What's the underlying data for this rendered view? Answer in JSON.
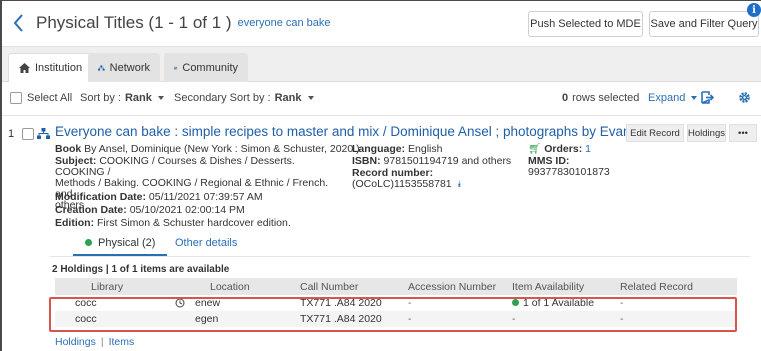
{
  "header": {
    "title": "Physical Titles (1 - 1 of 1 )",
    "query": "everyone can bake",
    "push_label": "Push Selected to MDE",
    "save_label": "Save and Filter Query",
    "info_badge": "i"
  },
  "tabs": [
    {
      "label": "Institution",
      "icon": "home-icon",
      "active": true
    },
    {
      "label": "Network",
      "icon": "network-icon",
      "active": false
    },
    {
      "label": "Community",
      "icon": "community-icon",
      "active": false
    }
  ],
  "toolbar": {
    "select_all": "Select All",
    "sort_label": "Sort by :",
    "sort_value": "Rank",
    "secondary_sort_label": "Secondary Sort by :",
    "secondary_sort_value": "Rank",
    "rows_selected_count": "0",
    "rows_selected_label": "rows selected",
    "expand_label": "Expand"
  },
  "record": {
    "number": "1",
    "title": "Everyone can bake : simple recipes to master and mix / Dominique Ansel ; photographs by Evan Sung.",
    "edit_record_label": "Edit Record",
    "holdings_label": "Holdings",
    "more_label": "•••",
    "book_type": "Book",
    "book_line": "By Ansel, Dominique (New York : Simon & Schuster, 2020.)",
    "subject_label": "Subject:",
    "subject_line1": "COOKING / Courses & Dishes / Desserts. COOKING /",
    "subject_line2": "Methods / Baking. COOKING / Regional & Ethnic / French. and",
    "subject_line3": "others",
    "modification_label": "Modification Date:",
    "modification_value": "05/11/2021 07:39:57 AM",
    "creation_label": "Creation Date:",
    "creation_value": "05/10/2021 02:00:14 PM",
    "edition_label": "Edition:",
    "edition_value": "First Simon & Schuster hardcover edition.",
    "language_label": "Language:",
    "language_value": "English",
    "isbn_label": "ISBN:",
    "isbn_value": "9781501194719 and others",
    "record_number_label": "Record number:",
    "record_number_value": "(OCoLC)1153558781",
    "orders_label": "Orders:",
    "orders_value": "1",
    "mms_label": "MMS ID:",
    "mms_value": "99377830101873"
  },
  "subtabs": {
    "physical": "Physical (2)",
    "other": "Other details"
  },
  "holdings": {
    "summary": "2 Holdings | 1 of 1 items are available",
    "columns": [
      "Library",
      "Location",
      "Call Number",
      "Accession Number",
      "Item Availability",
      "Related Record"
    ],
    "rows": [
      {
        "library": "cocc",
        "location": "enew",
        "call_number": "TX771 .A84 2020",
        "accession": "-",
        "availability": "1 of 1 Available",
        "related": "-"
      },
      {
        "library": "cocc",
        "location": "egen",
        "call_number": "TX771 .A84 2020",
        "accession": "-",
        "availability": "-",
        "related": "-"
      }
    ]
  },
  "bottom_links": {
    "holdings": "Holdings",
    "separator": "|",
    "items": "Items"
  },
  "colors": {
    "link_blue": "#2a6fb5",
    "highlight_red": "#d9534f",
    "available_green": "#2fa04c"
  }
}
